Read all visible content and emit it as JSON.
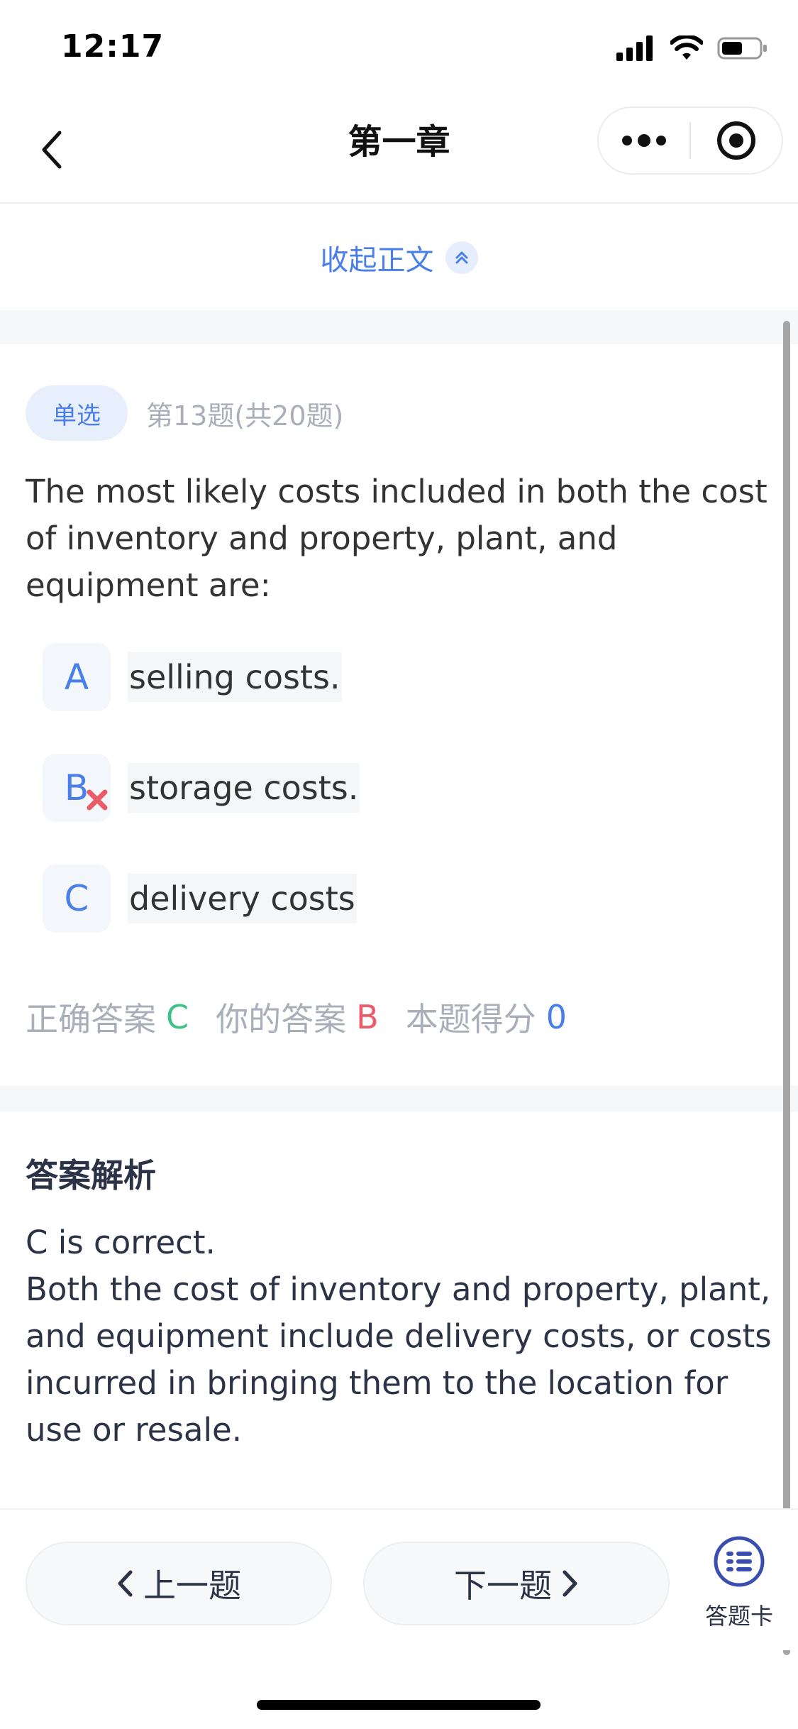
{
  "status_bar": {
    "time": "12:17"
  },
  "nav": {
    "title": "第一章"
  },
  "collapse": {
    "label": "收起正文"
  },
  "question": {
    "type_badge": "单选",
    "progress": "第13题(共20题)",
    "text": "The most likely costs included in both the cost of inventory and property, plant, and equipment are:",
    "options": [
      {
        "letter": "A",
        "text": "selling costs.",
        "state": "normal"
      },
      {
        "letter": "B",
        "text": "storage costs.",
        "state": "wrong"
      },
      {
        "letter": "C",
        "text": "delivery costs",
        "state": "normal"
      }
    ]
  },
  "result": {
    "correct_label": "正确答案",
    "correct_value": "C",
    "yours_label": "你的答案",
    "yours_value": "B",
    "score_label": "本题得分",
    "score_value": "0"
  },
  "analysis": {
    "title": "答案解析",
    "text": "C is correct.\nBoth the cost of inventory and property, plant, and equipment include delivery costs, or costs incurred in bringing them to the location for use or resale."
  },
  "bottom": {
    "prev_label": "上一题",
    "next_label": "下一题",
    "card_label": "答题卡"
  },
  "colors": {
    "accent": "#4a7ee8",
    "correct": "#3ec28a",
    "wrong": "#ec5b68",
    "muted": "#a9aeb8"
  }
}
